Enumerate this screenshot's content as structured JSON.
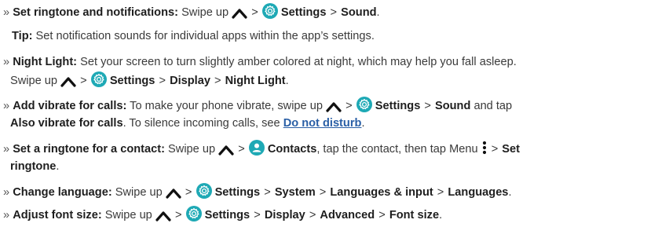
{
  "bullet": "»",
  "sep": ">",
  "colors": {
    "accent": "#1ea9b5",
    "link": "#2a5fa6",
    "text": "#3a3a3a"
  },
  "icons": {
    "up": "chevron-up-icon",
    "settings": "settings-gear-icon",
    "contacts": "contacts-person-icon",
    "menu": "menu-dots-icon"
  },
  "items": {
    "i1": {
      "title": "Set ringtone and notifications:",
      "t1": "Swipe up",
      "b1": "Settings",
      "b2": "Sound",
      "end": "."
    },
    "tip": {
      "title": "Tip:",
      "text": "Set notification sounds for individual apps within the app’s settings."
    },
    "i2": {
      "title": "Night Light:",
      "t1": "Set your screen to turn slightly amber colored at night, which may help you fall asleep.",
      "t2": "Swipe up",
      "b1": "Settings",
      "b2": "Display",
      "b3": "Night Light",
      "end": "."
    },
    "i3": {
      "title": "Add vibrate for calls:",
      "t1": "To make your phone vibrate, swipe up",
      "b1": "Settings",
      "b2": "Sound",
      "t2": "and tap",
      "b3": "Also vibrate for calls",
      "t3": ". To silence incoming calls, see",
      "link": "Do not disturb",
      "end": "."
    },
    "i4": {
      "title": "Set a ringtone for a contact:",
      "t1": "Swipe up",
      "b1": "Contacts",
      "t2": ", tap the contact, then tap Menu",
      "b2a": "Set",
      "b2b": "ringtone",
      "end": "."
    },
    "i5": {
      "title": "Change language:",
      "t1": "Swipe up",
      "b1": "Settings",
      "b2": "System",
      "b3": "Languages & input",
      "b4": "Languages",
      "end": "."
    },
    "i6": {
      "title": "Adjust font size:",
      "t1": "Swipe up",
      "b1": "Settings",
      "b2": "Display",
      "b3": "Advanced",
      "b4": "Font size",
      "end": "."
    }
  }
}
